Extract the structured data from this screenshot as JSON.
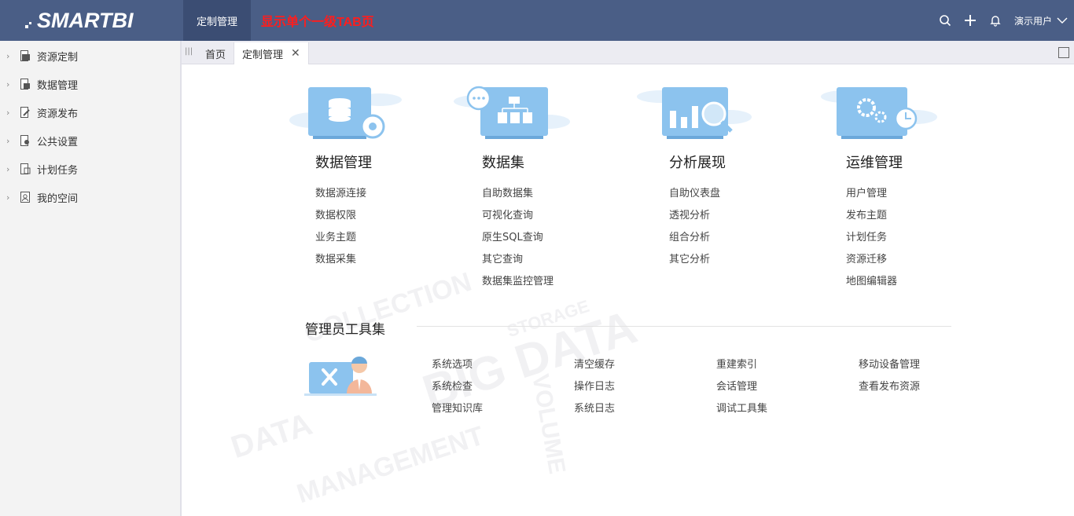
{
  "header": {
    "logo": "SMARTBI",
    "active_tab": "定制管理",
    "annotation": "显示单个一级TAB页",
    "user": "演示用户",
    "icons": [
      "search-icon",
      "plus-icon",
      "bell-icon"
    ]
  },
  "sidebar": {
    "items": [
      {
        "label": "资源定制"
      },
      {
        "label": "数据管理"
      },
      {
        "label": "资源发布"
      },
      {
        "label": "公共设置"
      },
      {
        "label": "计划任务"
      },
      {
        "label": "我的空间"
      }
    ]
  },
  "tabs": {
    "home": "首页",
    "current": "定制管理"
  },
  "categories": [
    {
      "title": "数据管理",
      "links": [
        "数据源连接",
        "数据权限",
        "业务主题",
        "数据采集"
      ]
    },
    {
      "title": "数据集",
      "links": [
        "自助数据集",
        "可视化查询",
        "原生SQL查询",
        "其它查询",
        "数据集监控管理"
      ]
    },
    {
      "title": "分析展现",
      "links": [
        "自助仪表盘",
        "透视分析",
        "组合分析",
        "其它分析"
      ]
    },
    {
      "title": "运维管理",
      "links": [
        "用户管理",
        "发布主题",
        "计划任务",
        "资源迁移",
        "地图编辑器"
      ]
    }
  ],
  "admin": {
    "title": "管理员工具集",
    "columns": [
      [
        "系统选项",
        "系统检查",
        "管理知识库"
      ],
      [
        "清空缓存",
        "操作日志",
        "系统日志"
      ],
      [
        "重建索引",
        "会话管理",
        "调试工具集"
      ],
      [
        "移动设备管理",
        "查看发布资源"
      ]
    ]
  },
  "colors": {
    "topbar": "#4a5e86",
    "active_top_tab": "#3b4d73",
    "annotation": "#ff1d1d",
    "illustration_blue": "#8cc3ee"
  }
}
